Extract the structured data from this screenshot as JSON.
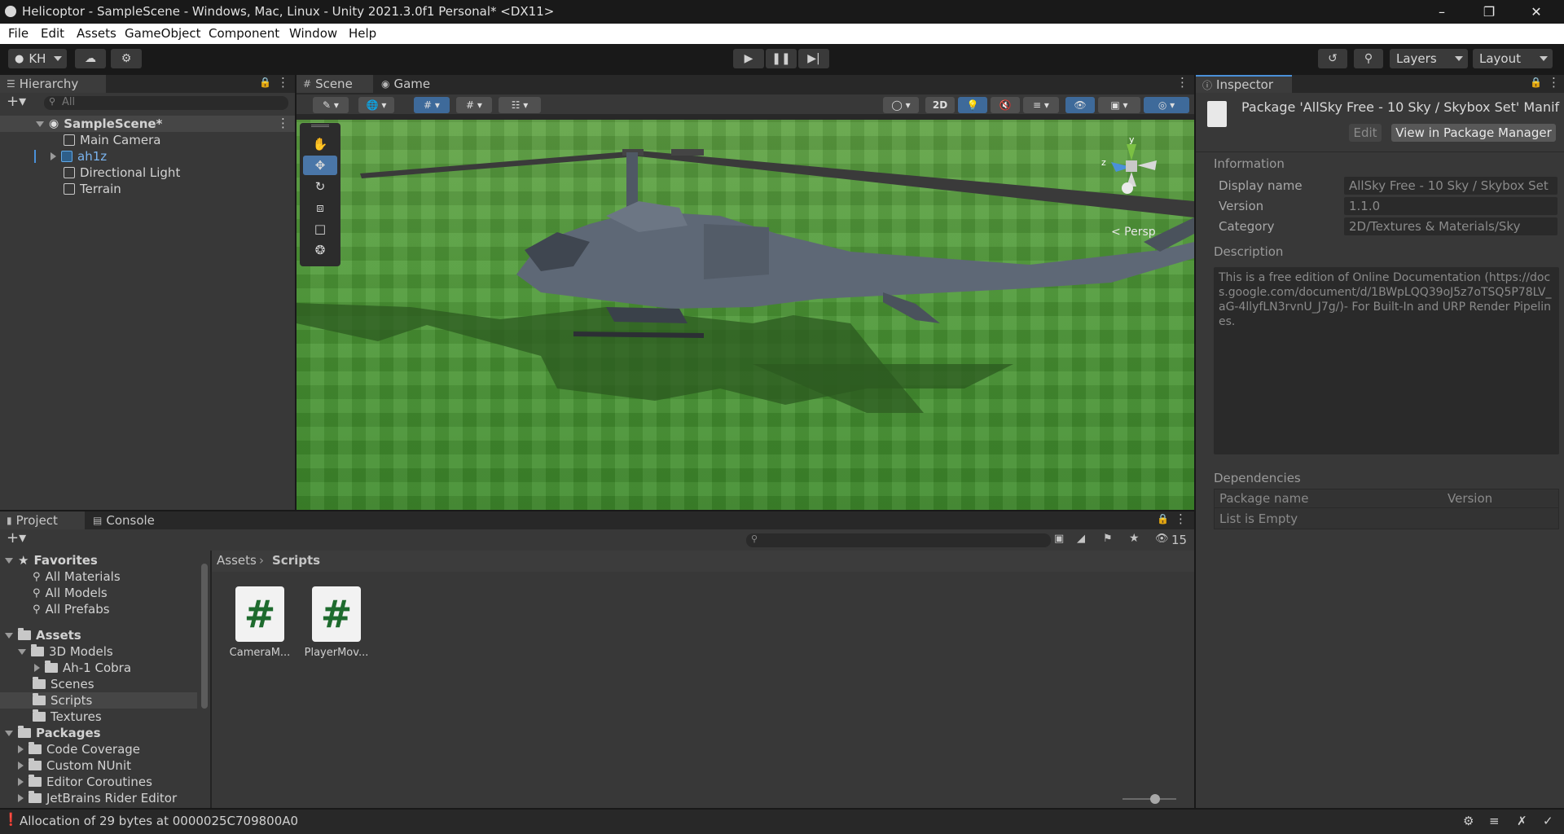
{
  "window": {
    "title": "Helicoptor - SampleScene - Windows, Mac, Linux - Unity 2021.3.0f1 Personal* <DX11>"
  },
  "menu": [
    "File",
    "Edit",
    "Assets",
    "GameObject",
    "Component",
    "Window",
    "Help"
  ],
  "toolbar": {
    "account_label": "KH",
    "layers_label": "Layers",
    "layout_label": "Layout"
  },
  "hierarchy": {
    "tab_label": "Hierarchy",
    "search_placeholder": "All",
    "scene_name": "SampleScene*",
    "items": [
      "Main Camera",
      "ah1z",
      "Directional Light",
      "Terrain"
    ]
  },
  "scene": {
    "tab_scene": "Scene",
    "tab_game": "Game",
    "mode_2d": "2D",
    "persp_label": "< Persp",
    "gizmo_y": "y",
    "gizmo_z": "z"
  },
  "inspector": {
    "tab_label": "Inspector",
    "header_title": "Package 'AllSky Free - 10 Sky / Skybox Set' Manif",
    "edit_label": "Edit",
    "view_pm_label": "View in Package Manager",
    "information_title": "Information",
    "fields": [
      {
        "label": "Display name",
        "value": "AllSky Free - 10 Sky / Skybox Set"
      },
      {
        "label": "Version",
        "value": "1.1.0"
      },
      {
        "label": "Category",
        "value": "2D/Textures & Materials/Sky"
      }
    ],
    "description_title": "Description",
    "description_text": "This is a free edition of Online Documentation (https://docs.google.com/document/d/1BWpLQQ39oJ5z7oTSQ5P78LV_aG-4llyfLN3rvnU_J7g/)- For Built-In and URP Render Pipelines.",
    "dependencies_title": "Dependencies",
    "dep_col_name": "Package name",
    "dep_col_version": "Version",
    "dep_empty": "List is Empty"
  },
  "project": {
    "tab_project": "Project",
    "tab_console": "Console",
    "hidden_count": "15",
    "breadcrumb_root": "Assets",
    "breadcrumb_current": "Scripts",
    "favorites_label": "Favorites",
    "favorites": [
      "All Materials",
      "All Models",
      "All Prefabs"
    ],
    "assets_label": "Assets",
    "assets_tree": [
      "3D Models",
      "Ah-1 Cobra",
      "Scenes",
      "Scripts",
      "Textures"
    ],
    "packages_label": "Packages",
    "packages_tree": [
      "Code Coverage",
      "Custom NUnit",
      "Editor Coroutines",
      "JetBrains Rider Editor"
    ],
    "files": [
      {
        "name": "CameraM...",
        "glyph": "#"
      },
      {
        "name": "PlayerMov...",
        "glyph": "#"
      }
    ]
  },
  "status": {
    "message": "Allocation of 29 bytes at 0000025C709800A0"
  },
  "colors": {
    "accent": "#4a76a8",
    "panel": "#383838",
    "grass": "#4e9a37"
  }
}
